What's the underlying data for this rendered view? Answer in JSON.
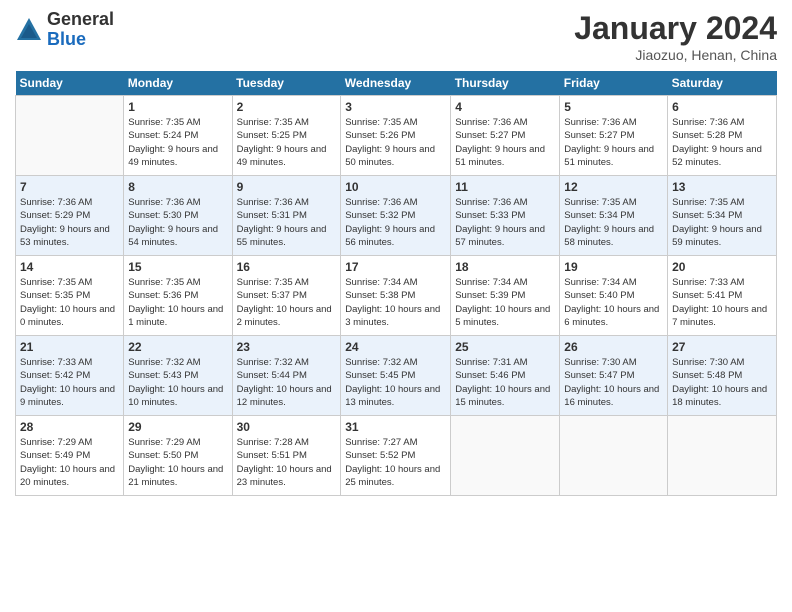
{
  "header": {
    "logo_general": "General",
    "logo_blue": "Blue",
    "month_title": "January 2024",
    "subtitle": "Jiaozuo, Henan, China"
  },
  "days_of_week": [
    "Sunday",
    "Monday",
    "Tuesday",
    "Wednesday",
    "Thursday",
    "Friday",
    "Saturday"
  ],
  "weeks": [
    [
      {
        "day": "",
        "sunrise": "",
        "sunset": "",
        "daylight": ""
      },
      {
        "day": "1",
        "sunrise": "Sunrise: 7:35 AM",
        "sunset": "Sunset: 5:24 PM",
        "daylight": "Daylight: 9 hours and 49 minutes."
      },
      {
        "day": "2",
        "sunrise": "Sunrise: 7:35 AM",
        "sunset": "Sunset: 5:25 PM",
        "daylight": "Daylight: 9 hours and 49 minutes."
      },
      {
        "day": "3",
        "sunrise": "Sunrise: 7:35 AM",
        "sunset": "Sunset: 5:26 PM",
        "daylight": "Daylight: 9 hours and 50 minutes."
      },
      {
        "day": "4",
        "sunrise": "Sunrise: 7:36 AM",
        "sunset": "Sunset: 5:27 PM",
        "daylight": "Daylight: 9 hours and 51 minutes."
      },
      {
        "day": "5",
        "sunrise": "Sunrise: 7:36 AM",
        "sunset": "Sunset: 5:27 PM",
        "daylight": "Daylight: 9 hours and 51 minutes."
      },
      {
        "day": "6",
        "sunrise": "Sunrise: 7:36 AM",
        "sunset": "Sunset: 5:28 PM",
        "daylight": "Daylight: 9 hours and 52 minutes."
      }
    ],
    [
      {
        "day": "7",
        "sunrise": "Sunrise: 7:36 AM",
        "sunset": "Sunset: 5:29 PM",
        "daylight": "Daylight: 9 hours and 53 minutes."
      },
      {
        "day": "8",
        "sunrise": "Sunrise: 7:36 AM",
        "sunset": "Sunset: 5:30 PM",
        "daylight": "Daylight: 9 hours and 54 minutes."
      },
      {
        "day": "9",
        "sunrise": "Sunrise: 7:36 AM",
        "sunset": "Sunset: 5:31 PM",
        "daylight": "Daylight: 9 hours and 55 minutes."
      },
      {
        "day": "10",
        "sunrise": "Sunrise: 7:36 AM",
        "sunset": "Sunset: 5:32 PM",
        "daylight": "Daylight: 9 hours and 56 minutes."
      },
      {
        "day": "11",
        "sunrise": "Sunrise: 7:36 AM",
        "sunset": "Sunset: 5:33 PM",
        "daylight": "Daylight: 9 hours and 57 minutes."
      },
      {
        "day": "12",
        "sunrise": "Sunrise: 7:35 AM",
        "sunset": "Sunset: 5:34 PM",
        "daylight": "Daylight: 9 hours and 58 minutes."
      },
      {
        "day": "13",
        "sunrise": "Sunrise: 7:35 AM",
        "sunset": "Sunset: 5:34 PM",
        "daylight": "Daylight: 9 hours and 59 minutes."
      }
    ],
    [
      {
        "day": "14",
        "sunrise": "Sunrise: 7:35 AM",
        "sunset": "Sunset: 5:35 PM",
        "daylight": "Daylight: 10 hours and 0 minutes."
      },
      {
        "day": "15",
        "sunrise": "Sunrise: 7:35 AM",
        "sunset": "Sunset: 5:36 PM",
        "daylight": "Daylight: 10 hours and 1 minute."
      },
      {
        "day": "16",
        "sunrise": "Sunrise: 7:35 AM",
        "sunset": "Sunset: 5:37 PM",
        "daylight": "Daylight: 10 hours and 2 minutes."
      },
      {
        "day": "17",
        "sunrise": "Sunrise: 7:34 AM",
        "sunset": "Sunset: 5:38 PM",
        "daylight": "Daylight: 10 hours and 3 minutes."
      },
      {
        "day": "18",
        "sunrise": "Sunrise: 7:34 AM",
        "sunset": "Sunset: 5:39 PM",
        "daylight": "Daylight: 10 hours and 5 minutes."
      },
      {
        "day": "19",
        "sunrise": "Sunrise: 7:34 AM",
        "sunset": "Sunset: 5:40 PM",
        "daylight": "Daylight: 10 hours and 6 minutes."
      },
      {
        "day": "20",
        "sunrise": "Sunrise: 7:33 AM",
        "sunset": "Sunset: 5:41 PM",
        "daylight": "Daylight: 10 hours and 7 minutes."
      }
    ],
    [
      {
        "day": "21",
        "sunrise": "Sunrise: 7:33 AM",
        "sunset": "Sunset: 5:42 PM",
        "daylight": "Daylight: 10 hours and 9 minutes."
      },
      {
        "day": "22",
        "sunrise": "Sunrise: 7:32 AM",
        "sunset": "Sunset: 5:43 PM",
        "daylight": "Daylight: 10 hours and 10 minutes."
      },
      {
        "day": "23",
        "sunrise": "Sunrise: 7:32 AM",
        "sunset": "Sunset: 5:44 PM",
        "daylight": "Daylight: 10 hours and 12 minutes."
      },
      {
        "day": "24",
        "sunrise": "Sunrise: 7:32 AM",
        "sunset": "Sunset: 5:45 PM",
        "daylight": "Daylight: 10 hours and 13 minutes."
      },
      {
        "day": "25",
        "sunrise": "Sunrise: 7:31 AM",
        "sunset": "Sunset: 5:46 PM",
        "daylight": "Daylight: 10 hours and 15 minutes."
      },
      {
        "day": "26",
        "sunrise": "Sunrise: 7:30 AM",
        "sunset": "Sunset: 5:47 PM",
        "daylight": "Daylight: 10 hours and 16 minutes."
      },
      {
        "day": "27",
        "sunrise": "Sunrise: 7:30 AM",
        "sunset": "Sunset: 5:48 PM",
        "daylight": "Daylight: 10 hours and 18 minutes."
      }
    ],
    [
      {
        "day": "28",
        "sunrise": "Sunrise: 7:29 AM",
        "sunset": "Sunset: 5:49 PM",
        "daylight": "Daylight: 10 hours and 20 minutes."
      },
      {
        "day": "29",
        "sunrise": "Sunrise: 7:29 AM",
        "sunset": "Sunset: 5:50 PM",
        "daylight": "Daylight: 10 hours and 21 minutes."
      },
      {
        "day": "30",
        "sunrise": "Sunrise: 7:28 AM",
        "sunset": "Sunset: 5:51 PM",
        "daylight": "Daylight: 10 hours and 23 minutes."
      },
      {
        "day": "31",
        "sunrise": "Sunrise: 7:27 AM",
        "sunset": "Sunset: 5:52 PM",
        "daylight": "Daylight: 10 hours and 25 minutes."
      },
      {
        "day": "",
        "sunrise": "",
        "sunset": "",
        "daylight": ""
      },
      {
        "day": "",
        "sunrise": "",
        "sunset": "",
        "daylight": ""
      },
      {
        "day": "",
        "sunrise": "",
        "sunset": "",
        "daylight": ""
      }
    ]
  ]
}
